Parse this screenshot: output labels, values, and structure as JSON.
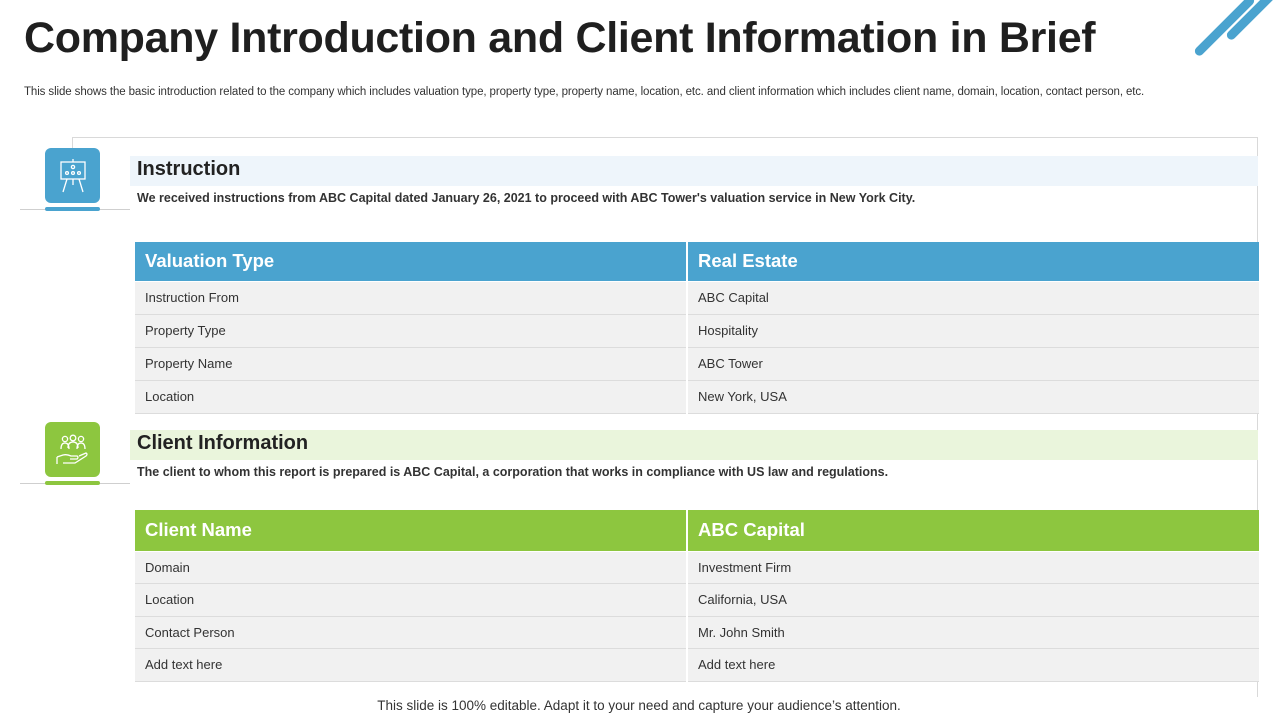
{
  "title": "Company Introduction and Client Information in Brief",
  "subtitle": "This slide shows the basic introduction related to the company which includes valuation type, property type,  property name, location, etc.  and client information which includes client name, domain, location, contact person, etc.",
  "colors": {
    "blue": "#4aa3cf",
    "green": "#8dc63f"
  },
  "instruction": {
    "icon": "presentation-board-icon",
    "title": "Instruction",
    "description": "We received instructions from ABC Capital dated January 26, 2021 to proceed with ABC Tower's valuation service in New York City.",
    "table": {
      "headers": [
        "Valuation Type",
        "Real Estate"
      ],
      "rows": [
        [
          "Instruction From",
          "ABC Capital"
        ],
        [
          "Property Type",
          "Hospitality"
        ],
        [
          "Property Name",
          "ABC Tower"
        ],
        [
          "Location",
          "New York, USA"
        ]
      ]
    }
  },
  "client": {
    "icon": "team-hand-icon",
    "title": "Client Information",
    "description": "The client to whom this report is prepared is ABC Capital, a corporation that works in compliance with US law and regulations.",
    "table": {
      "headers": [
        "Client Name",
        "ABC Capital"
      ],
      "rows": [
        [
          "Domain",
          "Investment Firm"
        ],
        [
          "Location",
          "California,  USA"
        ],
        [
          "Contact Person",
          "Mr. John Smith"
        ],
        [
          "Add text here",
          "Add text here"
        ]
      ]
    }
  },
  "footer": "This slide is 100% editable. Adapt it to your need and capture your audience’s attention."
}
